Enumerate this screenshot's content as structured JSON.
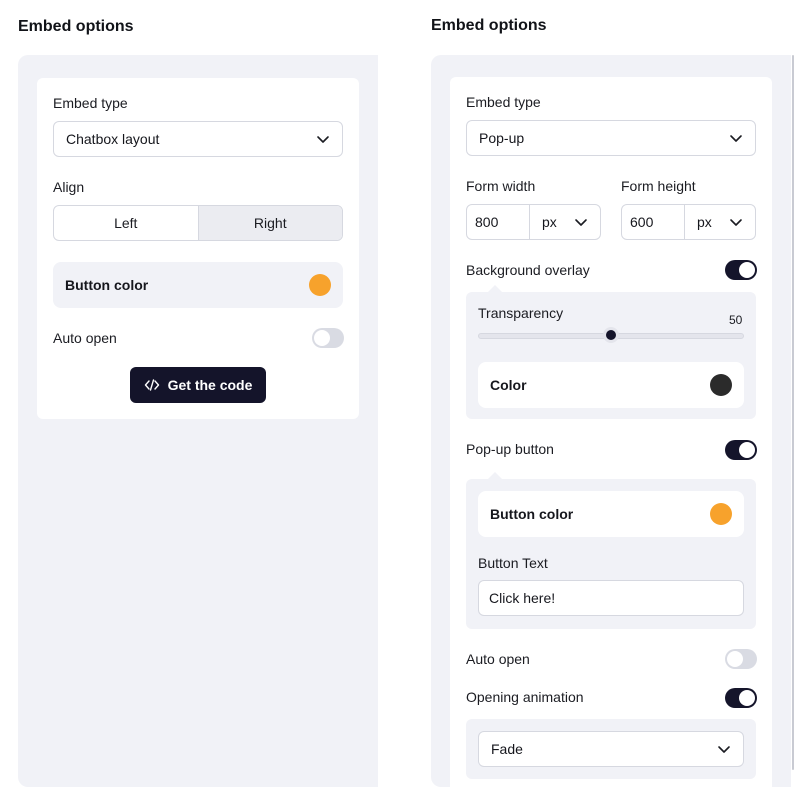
{
  "left": {
    "title": "Embed options",
    "embed_type_label": "Embed type",
    "embed_type_value": "Chatbox layout",
    "align_label": "Align",
    "align_options": [
      "Left",
      "Right"
    ],
    "align_selected": "Right",
    "button_color_label": "Button color",
    "button_color": "#f7a22c",
    "auto_open_label": "Auto open",
    "auto_open": false,
    "get_code_label": "Get the code"
  },
  "right": {
    "title": "Embed options",
    "embed_type_label": "Embed type",
    "embed_type_value": "Pop-up",
    "form_width_label": "Form width",
    "form_width_value": "800",
    "form_width_unit": "px",
    "form_height_label": "Form height",
    "form_height_value": "600",
    "form_height_unit": "px",
    "background_overlay_label": "Background overlay",
    "background_overlay": true,
    "transparency_label": "Transparency",
    "transparency_value": "50",
    "overlay_color_label": "Color",
    "overlay_color": "#2b2b2b",
    "popup_button_label": "Pop-up button",
    "popup_button": true,
    "button_color_label": "Button color",
    "button_color": "#f7a22c",
    "button_text_label": "Button Text",
    "button_text_value": "Click here!",
    "auto_open_label": "Auto open",
    "auto_open": false,
    "opening_animation_label": "Opening animation",
    "opening_animation": true,
    "animation_value": "Fade"
  },
  "colors": {
    "accent_dark": "#14142a",
    "panel_bg": "#f1f2f7",
    "orange": "#f7a22c"
  }
}
